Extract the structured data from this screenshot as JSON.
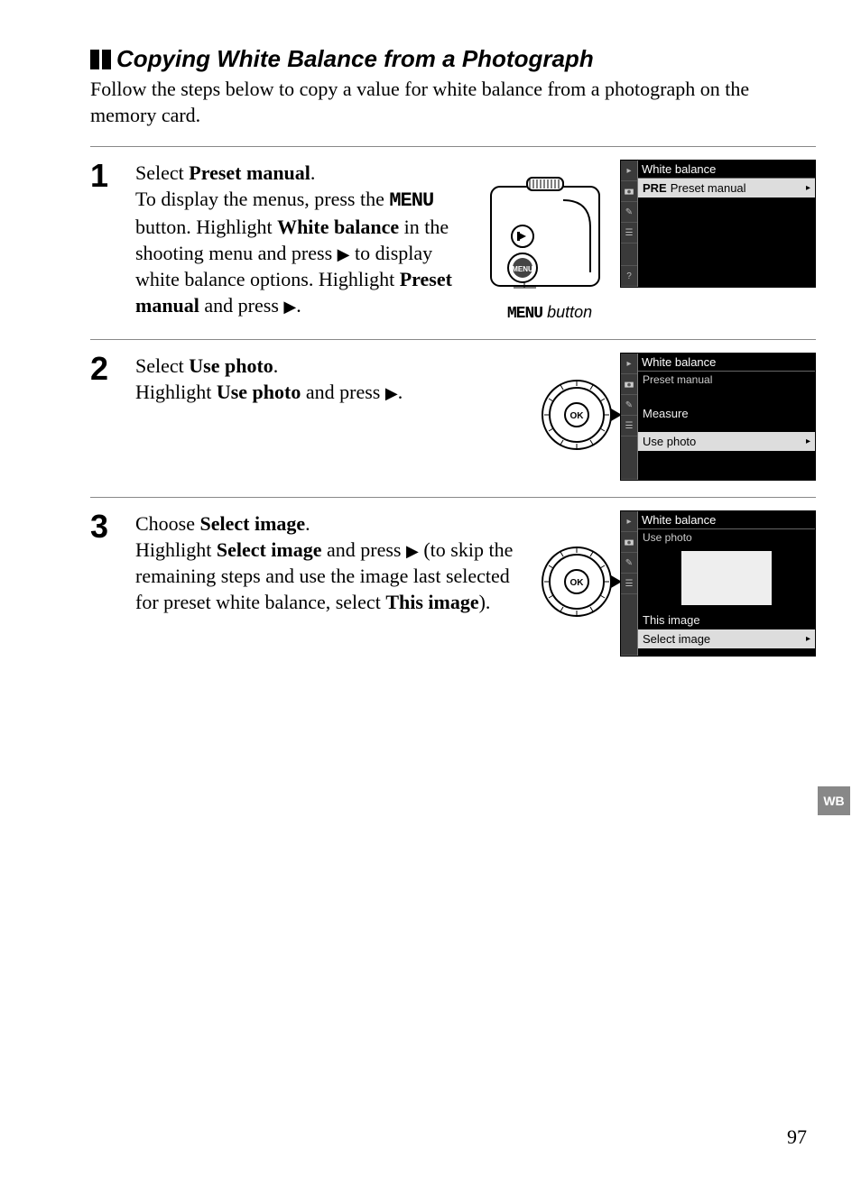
{
  "heading": "Copying White Balance from a Photograph",
  "intro": "Follow the steps below to copy a value for white balance from a photograph on the memory card.",
  "steps": {
    "1": {
      "num": "1",
      "lead": "Select ",
      "lead_bold": "Preset manual",
      "dot": ".",
      "line2a": "To display the menus, press the ",
      "line2_menu": "MENU",
      "line2b": " button. Highlight ",
      "line2_bold": "White balance",
      "line2c": " in the shooting menu and press ",
      "line2_tri": "▶",
      "line2d": " to display white balance options.",
      "line3a": "Highlight ",
      "line3_bold": "Preset manual",
      "line3b": " and press ",
      "line3_tri": "▶",
      "line3c": ".",
      "caption_menu": "MENU",
      "caption_rest": " button"
    },
    "2": {
      "num": "2",
      "lead": "Select ",
      "lead_bold": "Use photo",
      "dot": ".",
      "b2a": "Highlight ",
      "b2_bold": "Use photo",
      "b2b": " and press ",
      "b2_tri": "▶",
      "b2c": "."
    },
    "3": {
      "num": "3",
      "lead": "Choose ",
      "lead_bold": "Select image",
      "dot": ".",
      "b3a": "Highlight ",
      "b3_bold": "Select image",
      "b3b": " and press ",
      "b3_tri": "▶",
      "b3c": " (to skip the remaining steps and use the image last selected for preset white balance, select ",
      "b3_bold2": "This image",
      "b3d": ")."
    }
  },
  "screens": {
    "s1": {
      "title": "White balance",
      "item_prefix": "PRE",
      "item": "Preset manual"
    },
    "s2": {
      "title": "White balance",
      "sub": "Preset manual",
      "i1": "Measure",
      "i2": "Use photo"
    },
    "s3": {
      "title": "White balance",
      "sub": "Use photo",
      "i1": "This image",
      "i2": "Select image"
    }
  },
  "tab": "WB",
  "pagenum": "97"
}
